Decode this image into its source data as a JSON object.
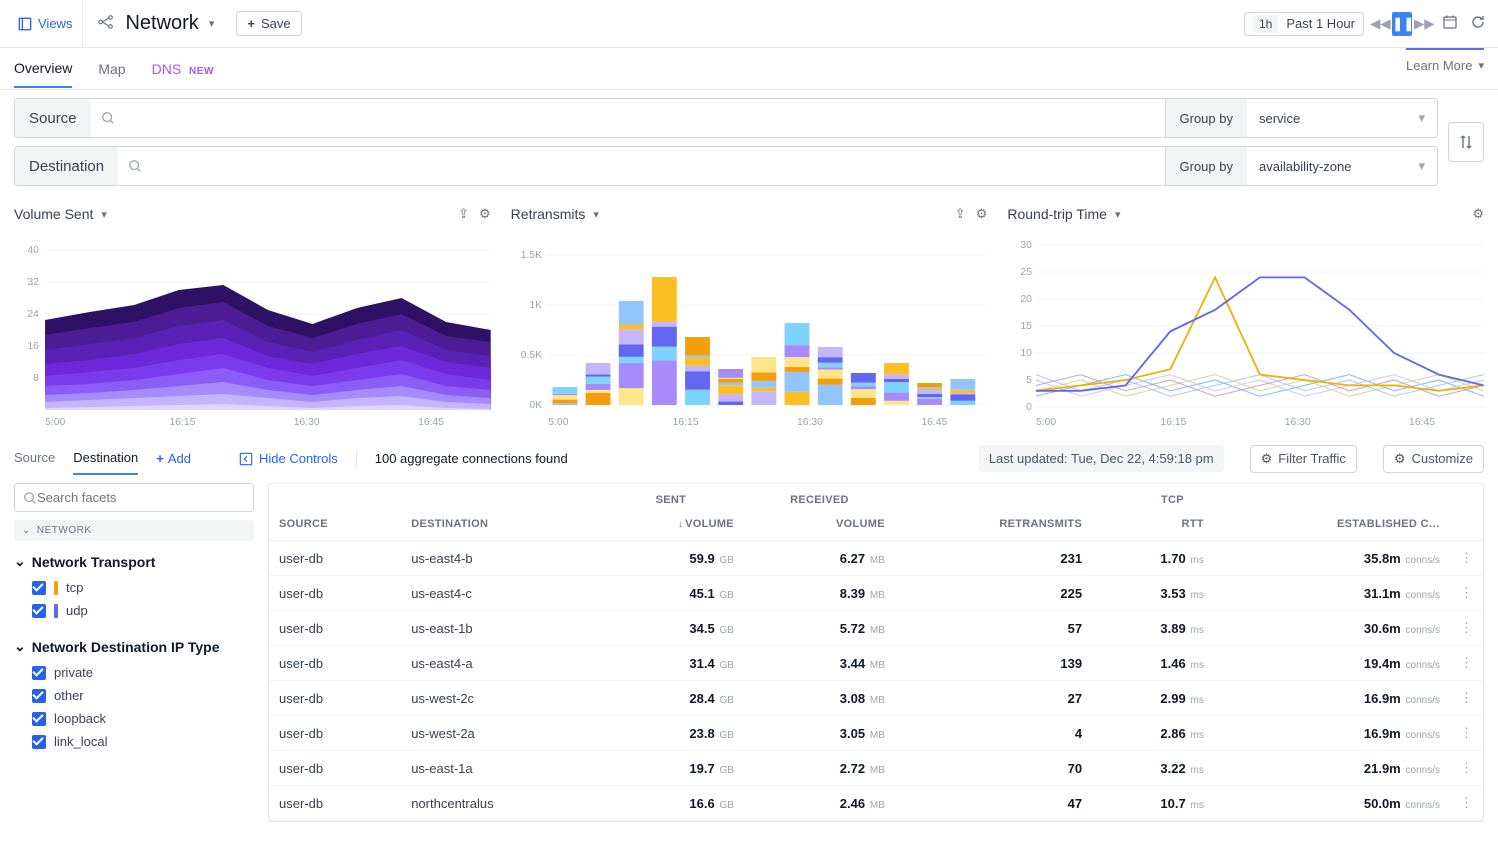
{
  "topbar": {
    "views_label": "Views",
    "page_title": "Network",
    "save_label": "Save",
    "timerange_badge": "1h",
    "timerange_label": "Past 1 Hour"
  },
  "subnav": {
    "tabs": [
      "Overview",
      "Map"
    ],
    "dns_label": "DNS",
    "dns_badge": "NEW",
    "learn_more": "Learn More"
  },
  "filters": {
    "source_label": "Source",
    "destination_label": "Destination",
    "groupby_label": "Group by",
    "source_group_value": "service",
    "destination_group_value": "availability-zone"
  },
  "chart_titles": {
    "a": "Volume Sent",
    "b": "Retransmits",
    "c": "Round-trip Time"
  },
  "chart_data": [
    {
      "id": "volume_sent",
      "type": "area",
      "title": "Volume Sent",
      "x": [
        "5:00",
        "16:15",
        "16:30",
        "16:45"
      ],
      "ylim": [
        0,
        40
      ],
      "yticks": [
        0,
        8,
        16,
        24,
        32,
        40
      ],
      "stack_totals": [
        25,
        27,
        29,
        33,
        27,
        24,
        26,
        29,
        25,
        23,
        22
      ],
      "note": "stacked multi-series; per-series values not legible"
    },
    {
      "id": "retransmits",
      "type": "bar",
      "title": "Retransmits",
      "x": [
        "5:00",
        "16:15",
        "16:30",
        "16:45"
      ],
      "yticks": [
        "0K",
        "0.5K",
        "1K",
        "1.5K"
      ],
      "ylim": [
        0,
        1500
      ],
      "stack_totals": [
        180,
        420,
        1040,
        1280,
        680,
        360,
        480,
        820,
        580,
        320,
        420,
        220,
        260
      ],
      "note": "stacked multi-series bar; per-series values not legible"
    },
    {
      "id": "rtt",
      "type": "line",
      "title": "Round-trip Time",
      "x": [
        "5:00",
        "16:15",
        "16:30",
        "16:45"
      ],
      "yticks": [
        0,
        5,
        10,
        15,
        20,
        25,
        30
      ],
      "ylim": [
        0,
        30
      ],
      "highlighted_series": [
        {
          "name": "series-a",
          "values": [
            3,
            4,
            5,
            7,
            24,
            6,
            5,
            4,
            4,
            3,
            4
          ]
        },
        {
          "name": "series-b",
          "values": [
            3,
            3,
            4,
            14,
            18,
            24,
            24,
            18,
            10,
            6,
            4
          ]
        }
      ],
      "note": "many overlapping low-value series around 2–6"
    }
  ],
  "results": {
    "tabs": {
      "source": "Source",
      "destination": "Destination",
      "add": "Add"
    },
    "hide_controls": "Hide Controls",
    "status": "100 aggregate connections found",
    "last_updated": "Last updated: Tue, Dec 22, 4:59:18 pm",
    "filter_traffic": "Filter Traffic",
    "customize": "Customize"
  },
  "facets": {
    "search_placeholder": "Search facets",
    "group_network": "NETWORK",
    "transport_hdr": "Network Transport",
    "transport": [
      {
        "label": "tcp",
        "color": "#f59e0b"
      },
      {
        "label": "udp",
        "color": "#6366f1"
      }
    ],
    "ip_type_hdr": "Network Destination IP Type",
    "ip_types": [
      "private",
      "other",
      "loopback",
      "link_local"
    ]
  },
  "table": {
    "group_headers": {
      "sent": "SENT",
      "received": "RECEIVED",
      "tcp": "TCP"
    },
    "headers": {
      "source": "SOURCE",
      "destination": "DESTINATION",
      "sent_volume": "VOLUME",
      "recv_volume": "VOLUME",
      "retransmits": "RETRANSMITS",
      "rtt": "RTT",
      "established": "ESTABLISHED C…"
    },
    "rows": [
      {
        "source": "user-db",
        "dest": "us-east4-b",
        "sent_v": "59.9",
        "sent_u": "GB",
        "recv_v": "6.27",
        "recv_u": "MB",
        "retx": "231",
        "rtt": "1.70",
        "rtt_u": "ms",
        "est": "35.8m",
        "est_u": "conns/s"
      },
      {
        "source": "user-db",
        "dest": "us-east4-c",
        "sent_v": "45.1",
        "sent_u": "GB",
        "recv_v": "8.39",
        "recv_u": "MB",
        "retx": "225",
        "rtt": "3.53",
        "rtt_u": "ms",
        "est": "31.1m",
        "est_u": "conns/s"
      },
      {
        "source": "user-db",
        "dest": "us-east-1b",
        "sent_v": "34.5",
        "sent_u": "GB",
        "recv_v": "5.72",
        "recv_u": "MB",
        "retx": "57",
        "rtt": "3.89",
        "rtt_u": "ms",
        "est": "30.6m",
        "est_u": "conns/s"
      },
      {
        "source": "user-db",
        "dest": "us-east4-a",
        "sent_v": "31.4",
        "sent_u": "GB",
        "recv_v": "3.44",
        "recv_u": "MB",
        "retx": "139",
        "rtt": "1.46",
        "rtt_u": "ms",
        "est": "19.4m",
        "est_u": "conns/s"
      },
      {
        "source": "user-db",
        "dest": "us-west-2c",
        "sent_v": "28.4",
        "sent_u": "GB",
        "recv_v": "3.08",
        "recv_u": "MB",
        "retx": "27",
        "rtt": "2.99",
        "rtt_u": "ms",
        "est": "16.9m",
        "est_u": "conns/s"
      },
      {
        "source": "user-db",
        "dest": "us-west-2a",
        "sent_v": "23.8",
        "sent_u": "GB",
        "recv_v": "3.05",
        "recv_u": "MB",
        "retx": "4",
        "rtt": "2.86",
        "rtt_u": "ms",
        "est": "16.9m",
        "est_u": "conns/s"
      },
      {
        "source": "user-db",
        "dest": "us-east-1a",
        "sent_v": "19.7",
        "sent_u": "GB",
        "recv_v": "2.72",
        "recv_u": "MB",
        "retx": "70",
        "rtt": "3.22",
        "rtt_u": "ms",
        "est": "21.9m",
        "est_u": "conns/s"
      },
      {
        "source": "user-db",
        "dest": "northcentralus",
        "sent_v": "16.6",
        "sent_u": "GB",
        "recv_v": "2.46",
        "recv_u": "MB",
        "retx": "47",
        "rtt": "10.7",
        "rtt_u": "ms",
        "est": "50.0m",
        "est_u": "conns/s"
      }
    ]
  }
}
